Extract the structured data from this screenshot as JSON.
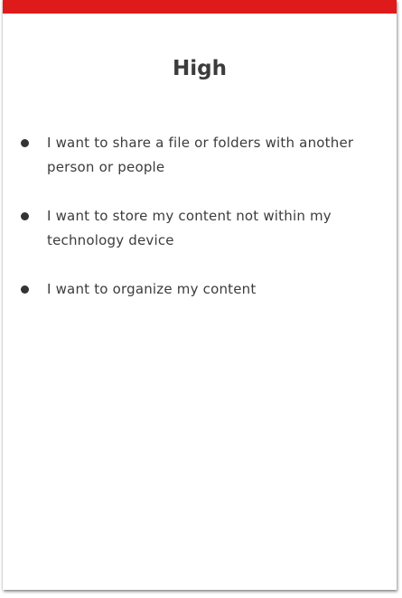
{
  "card": {
    "title": "High",
    "accent_color": "#de1a1a",
    "items": [
      {
        "text": "I want to share a file or folders with another person or people"
      },
      {
        "text": "I want to store my content not within my technology device"
      },
      {
        "text": "I want to organize my content"
      }
    ]
  }
}
